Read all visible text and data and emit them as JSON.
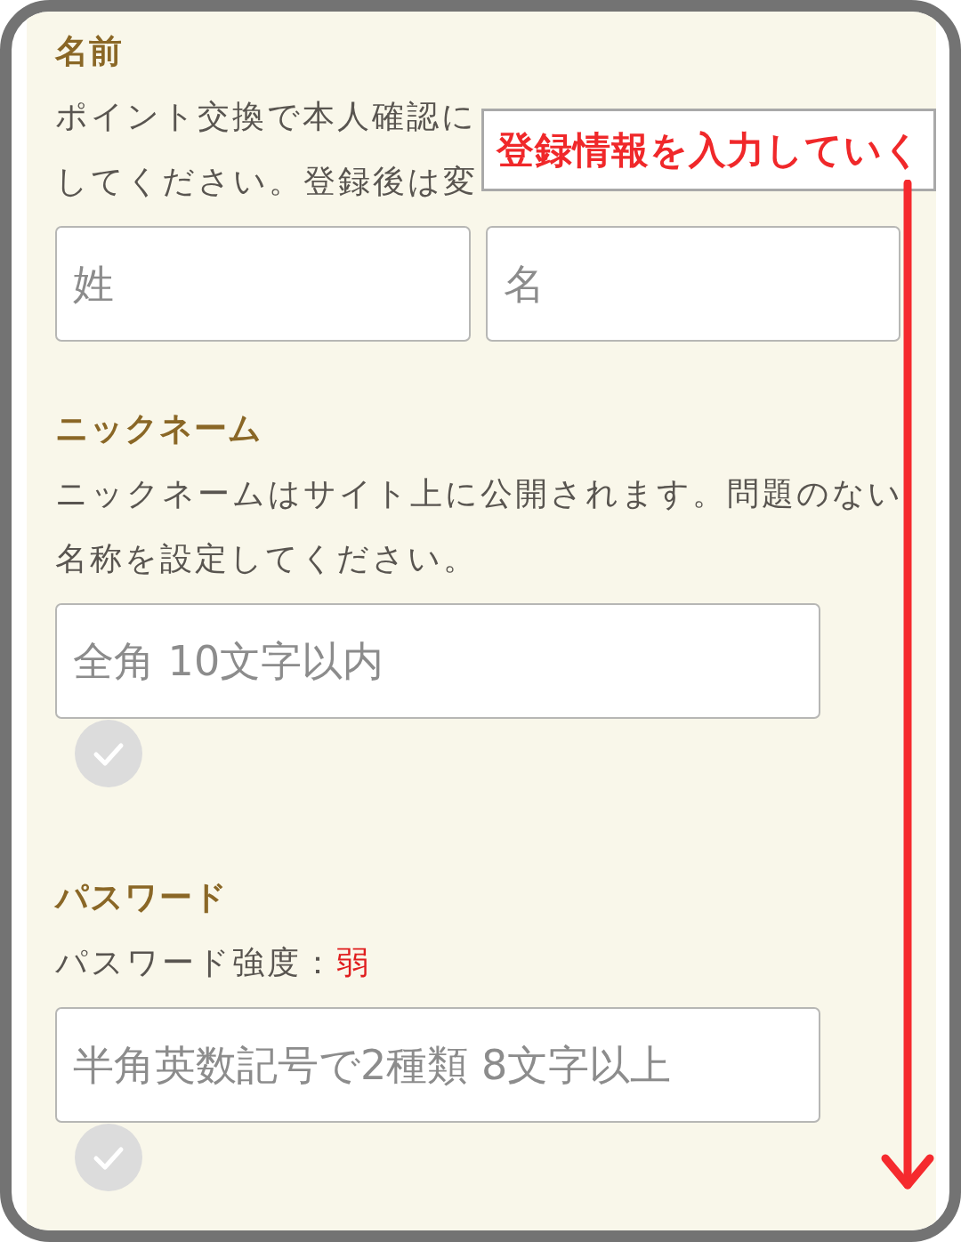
{
  "annotation": {
    "text": "登録情報を入力していく"
  },
  "sections": [
    {
      "heading": "名前",
      "description_lines": [
        "ポイント交換で本人確認に",
        "してください。登録後は変"
      ],
      "fields": [
        {
          "placeholder": "姓"
        },
        {
          "placeholder": "名"
        }
      ]
    },
    {
      "heading": "ニックネーム",
      "description_lines": [
        "ニックネームはサイト上に公開されます。問題のない",
        "名称を設定してください。"
      ],
      "fields": [
        {
          "placeholder": "全角 10文字以内",
          "valid": false
        }
      ]
    },
    {
      "heading": "パスワード",
      "strength": {
        "label": "パスワード強度：",
        "value": "弱"
      },
      "fields": [
        {
          "placeholder": "半角英数記号で2種類 8文字以上",
          "valid": false
        }
      ]
    }
  ]
}
